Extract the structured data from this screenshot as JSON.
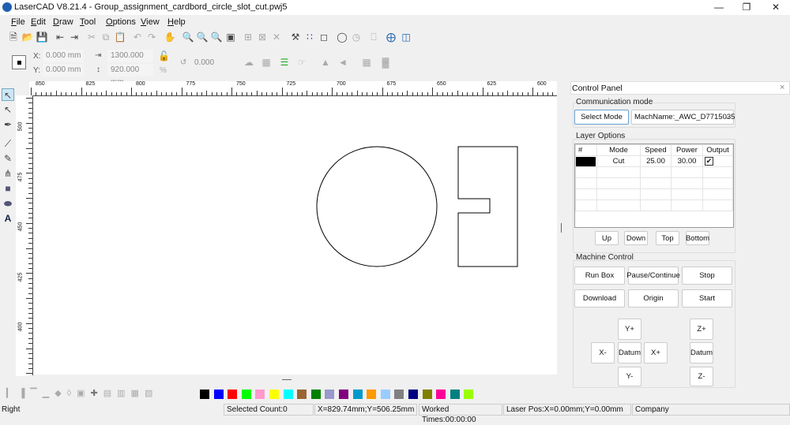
{
  "window": {
    "title": "LaserCAD V8.21.4 - Group_assignment_cardbord_circle_slot_cut.pwj5"
  },
  "menu": [
    "File",
    "Edit",
    "Draw",
    "Tool",
    "Options",
    "View",
    "Help"
  ],
  "position": {
    "x_label": "X:",
    "x_value": "0.000 mm",
    "y_label": "Y:",
    "y_value": "0.000 mm",
    "width_value": "1300.000 mm",
    "height_value": "920.000 mm",
    "percent": "%",
    "rotate_value": "0.000"
  },
  "ruler": {
    "top_labels": [
      "850",
      "825",
      "800",
      "775",
      "750",
      "725",
      "700",
      "675",
      "650",
      "625",
      "600"
    ],
    "left_labels": [
      "500",
      "475",
      "450",
      "425",
      "400"
    ]
  },
  "control_panel": {
    "title": "Control Panel",
    "communication": {
      "title": "Communication mode",
      "select_mode": "Select Mode",
      "machine": "MachName:_AWC_D7715035"
    },
    "layers": {
      "title": "Layer Options",
      "headers": [
        "#",
        "Mode",
        "Speed",
        "Power",
        "Output"
      ],
      "rows": [
        {
          "color": "#000000",
          "mode": "Cut",
          "speed": "25.00",
          "power": "30.00",
          "output": true
        }
      ],
      "buttons": [
        "Up",
        "Down",
        "Top",
        "Bottom"
      ]
    },
    "machine": {
      "title": "Machine Control",
      "buttons": [
        "Run Box",
        "Pause/Continue",
        "Stop",
        "Download",
        "Origin",
        "Start"
      ],
      "jog": {
        "y_plus": "Y+",
        "x_minus": "X-",
        "datum": "Datum",
        "x_plus": "X+",
        "y_minus": "Y-",
        "z_plus": "Z+",
        "z_datum": "Datum",
        "z_minus": "Z-"
      }
    }
  },
  "palette": [
    "#000000",
    "#0000ff",
    "#ff0000",
    "#00ff00",
    "#ff99cc",
    "#ffff00",
    "#00ffff",
    "#996633",
    "#008000",
    "#9999cc",
    "#800080",
    "#0099cc",
    "#ff9900",
    "#99ccff",
    "#808080",
    "#000080",
    "#808000",
    "#ff0099",
    "#008080",
    "#99ff00"
  ],
  "status": {
    "left": "Right",
    "selected": "Selected Count:0",
    "coords": "X=829.74mm;Y=506.25mm",
    "worked": "Worked Times:00:00:00",
    "laser_pos": "Laser Pos:X=0.00mm;Y=0.00mm",
    "company": "Company"
  }
}
